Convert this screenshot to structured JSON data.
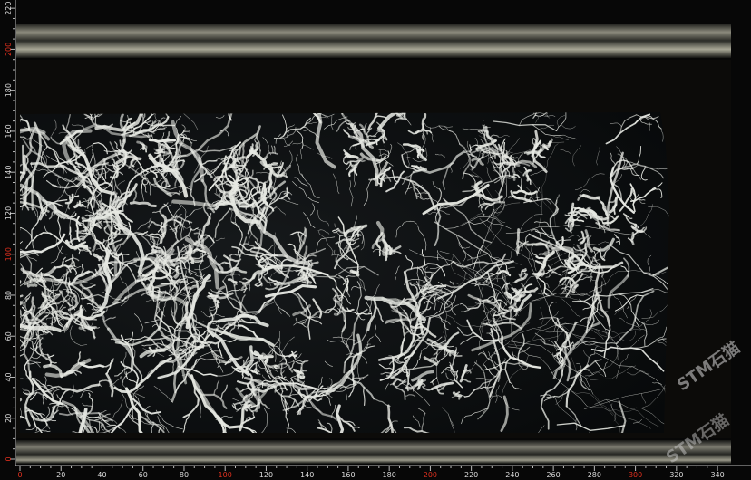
{
  "image": {
    "subject": "black marble slab with white veins",
    "colors": {
      "background": "#070707",
      "slab": "#0b0d0e",
      "vein": "#e6e8e2",
      "scale_major": "#e0301e",
      "scale_minor": "#dcdcdc"
    }
  },
  "scale": {
    "x": {
      "min": 0,
      "max": 340,
      "step": 20,
      "labels": [
        "0",
        "20",
        "40",
        "60",
        "80",
        "100",
        "120",
        "140",
        "160",
        "180",
        "200",
        "220",
        "240",
        "260",
        "280",
        "300",
        "320",
        "340"
      ],
      "highlight": [
        "0",
        "100",
        "200",
        "300"
      ]
    },
    "y": {
      "min": 0,
      "max": 220,
      "step": 20,
      "labels": [
        "0",
        "20",
        "40",
        "60",
        "80",
        "100",
        "120",
        "140",
        "160",
        "180",
        "200",
        "220"
      ],
      "highlight": [
        "0",
        "100",
        "200"
      ]
    }
  },
  "watermark": {
    "lines": [
      "STM石猫",
      "STM石猫"
    ]
  }
}
